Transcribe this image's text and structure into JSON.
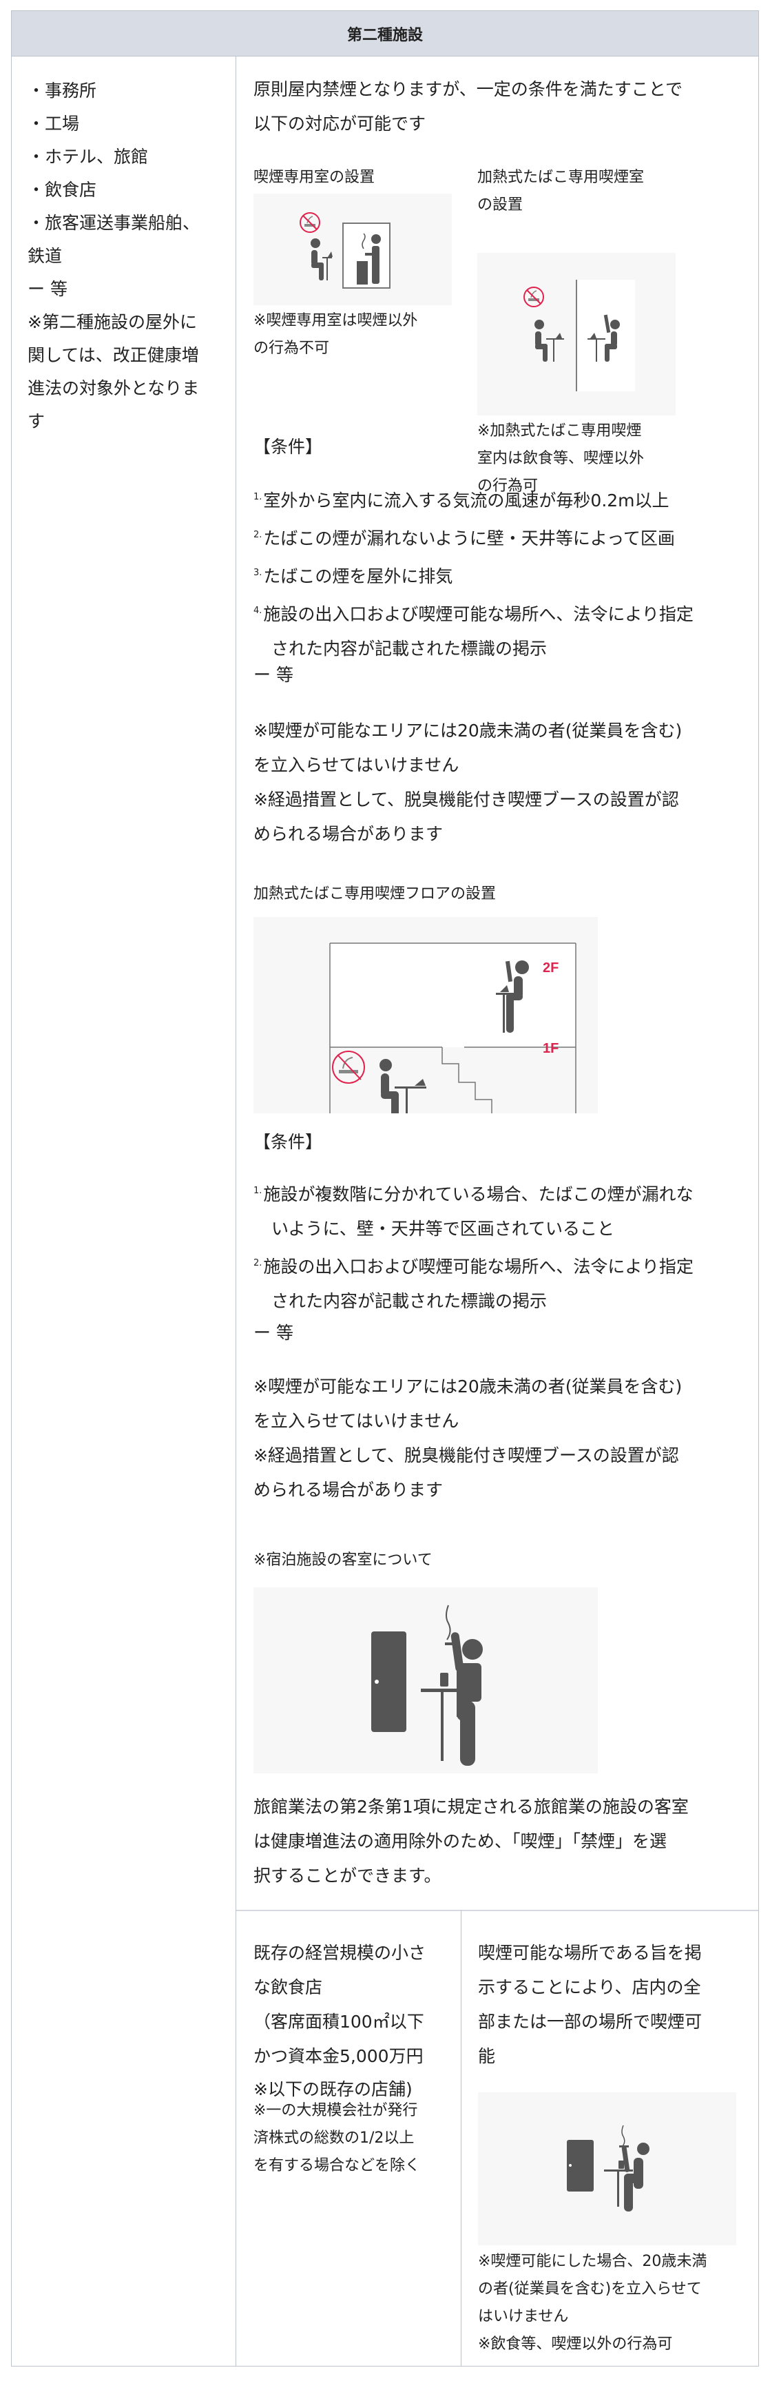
{
  "header": {
    "title": "第二種施設"
  },
  "left_column": {
    "lines": [
      "・事務所",
      "・工場",
      "・ホテル、旅館",
      "・飲食店",
      "・旅客運送事業船舶、",
      "鉄道",
      "ー 等",
      "※第二種施設の屋外に",
      "関しては、改正健康増",
      "進法の対象外となりま",
      "す"
    ]
  },
  "main": {
    "intro": [
      "原則屋内禁煙となりますが、一定の条件を満たすことで",
      "以下の対応が可能です"
    ],
    "options": [
      {
        "title": [
          "喫煙専用室の設置"
        ],
        "image": "smoking-room-icon",
        "note": [
          "※喫煙専用室は喫煙以外",
          "の行為不可"
        ]
      },
      {
        "title": [
          "加熱式たばこ専用喫煙室",
          "の設置"
        ],
        "image": "heated-tobacco-room-icon",
        "note": [
          "※加熱式たばこ専用喫煙",
          "室内は飲食等、喫煙以外",
          "の行為可"
        ]
      }
    ],
    "conditions_1": {
      "heading": "【条件】",
      "items": [
        {
          "num": "1.",
          "lines": [
            "室外から室内に流入する気流の風速が毎秒0.2m以上"
          ]
        },
        {
          "num": "2.",
          "lines": [
            "たばこの煙が漏れないように壁・天井等によって区画"
          ]
        },
        {
          "num": "3.",
          "lines": [
            "たばこの煙を屋外に排気"
          ]
        },
        {
          "num": "4.",
          "lines": [
            "施設の出入口および喫煙可能な場所へ、法令により指定",
            "された内容が記載された標識の掲示"
          ]
        }
      ],
      "etc": "ー 等",
      "notes": [
        "※喫煙が可能なエリアには20歳未満の者(従業員を含む)",
        "を立入らせてはいけません",
        "※経過措置として、脱臭機能付き喫煙ブースの設置が認",
        "められる場合があります"
      ]
    },
    "floor_section": {
      "title": "加熱式たばこ専用喫煙フロアの設置",
      "labels": {
        "upper": "2F",
        "lower": "1F"
      },
      "accent_color": "#e0234e"
    },
    "conditions_2": {
      "heading": "【条件】",
      "items": [
        {
          "num": "1.",
          "lines": [
            "施設が複数階に分かれている場合、たばこの煙が漏れな",
            "いように、壁・天井等で区画されていること"
          ]
        },
        {
          "num": "2.",
          "lines": [
            "施設の出入口および喫煙可能な場所へ、法令により指定",
            "された内容が記載された標識の掲示"
          ]
        }
      ],
      "etc": "ー 等",
      "notes": [
        "※喫煙が可能なエリアには20歳未満の者(従業員を含む)",
        "を立入らせてはいけません",
        "※経過措置として、脱臭機能付き喫煙ブースの設置が認",
        "められる場合があります"
      ]
    },
    "lodging": {
      "title": "※宿泊施設の客室について",
      "text": [
        "旅館業法の第2条第1項に規定される旅館業の施設の客室",
        "は健康増進法の適用除外のため、「喫煙」「禁煙」を選",
        "択することができます。"
      ]
    }
  },
  "bottom_row": {
    "left": {
      "lines": [
        "既存の経営規模の小さ",
        "な飲食店",
        "（客席面積100㎡以下",
        "かつ資本金5,000万円",
        "※以下の既存の店舗)"
      ],
      "small_lines": [
        "※一の大規模会社が発行",
        "済株式の総数の1/2以上",
        "を有する場合などを除く"
      ]
    },
    "right": {
      "lines": [
        "喫煙可能な場所である旨を掲",
        "示することにより、店内の全",
        "部または一部の場所で喫煙可",
        "能"
      ],
      "notes": [
        "※喫煙可能にした場合、20歳未満",
        "の者(従業員を含む)を立入らせて",
        "はいけません",
        "※飲食等、喫煙以外の行為可"
      ]
    }
  },
  "colors": {
    "header_bg": "#d8dce4",
    "border": "#bcc3cc",
    "icon_gray": "#555555",
    "no_smoking_red": "#e0234e",
    "image_bg": "#f7f7f7"
  }
}
